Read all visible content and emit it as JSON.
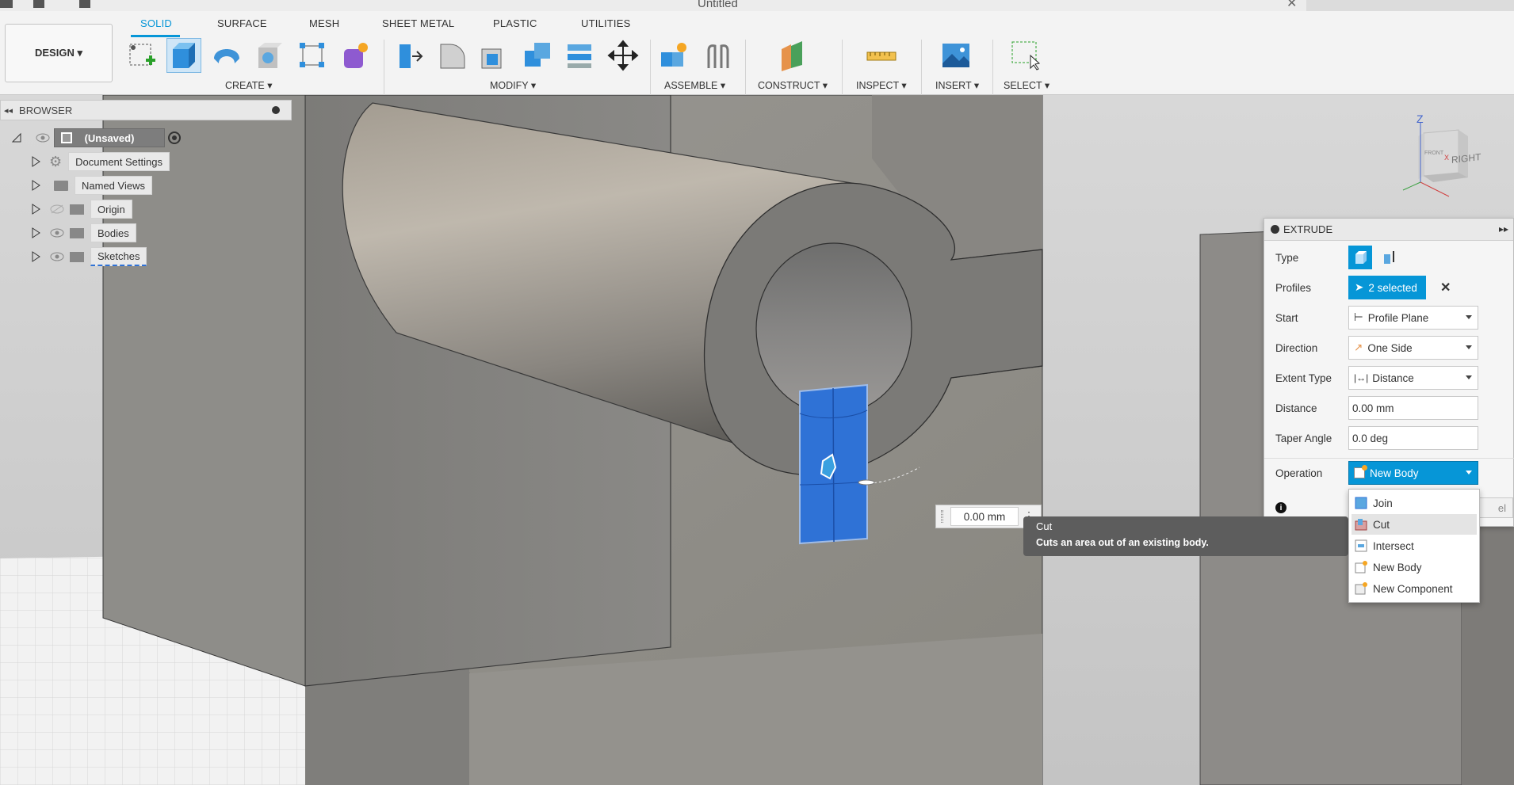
{
  "window": {
    "title": "Untitled"
  },
  "ribbon": {
    "workspace": "DESIGN ▾",
    "tabs": [
      "SOLID",
      "SURFACE",
      "MESH",
      "SHEET METAL",
      "PLASTIC",
      "UTILITIES"
    ],
    "active_tab": "SOLID",
    "groups": {
      "create": "CREATE ▾",
      "modify": "MODIFY ▾",
      "assemble": "ASSEMBLE ▾",
      "construct": "CONSTRUCT ▾",
      "inspect": "INSPECT ▾",
      "insert": "INSERT ▾",
      "select": "SELECT ▾"
    }
  },
  "browser": {
    "title": "BROWSER",
    "root": "(Unsaved)",
    "items": [
      {
        "label": "Document Settings",
        "icon": "gear-icon"
      },
      {
        "label": "Named Views",
        "icon": "folder-icon"
      },
      {
        "label": "Origin",
        "icon": "folder-icon"
      },
      {
        "label": "Bodies",
        "icon": "folder-icon"
      },
      {
        "label": "Sketches",
        "icon": "folder-icon"
      }
    ]
  },
  "viewcube": {
    "face": "RIGHT",
    "axis_z": "Z",
    "axis_x": "X",
    "front": "FRONT"
  },
  "extrude": {
    "title": "EXTRUDE",
    "labels": {
      "type": "Type",
      "profiles": "Profiles",
      "start": "Start",
      "direction": "Direction",
      "extent_type": "Extent Type",
      "distance": "Distance",
      "taper_angle": "Taper Angle",
      "operation": "Operation"
    },
    "profiles_value": "2 selected",
    "start_value": "Profile Plane",
    "direction_value": "One Side",
    "extent_type_value": "Distance",
    "distance_value": "0.00 mm",
    "taper_angle_value": "0.0 deg",
    "operation_value": "New Body",
    "cancel_fragment": "el"
  },
  "operation_menu": {
    "items": [
      "Join",
      "Cut",
      "Intersect",
      "New Body",
      "New Component"
    ],
    "highlighted": "Cut"
  },
  "tooltip": {
    "title": "Cut",
    "description": "Cuts an area out of an existing body."
  },
  "canvas_input": {
    "value": "0.00 mm"
  },
  "colors": {
    "accent": "#0696d7",
    "selection": "#2f72d6",
    "body": "#8a8884"
  }
}
